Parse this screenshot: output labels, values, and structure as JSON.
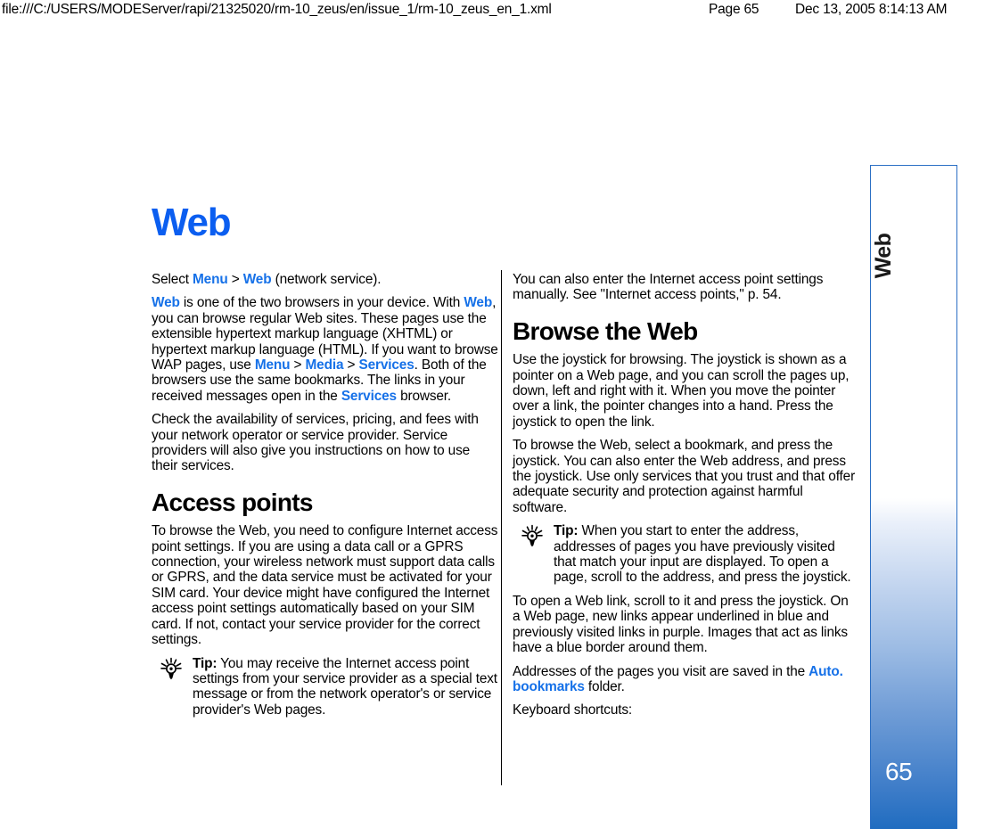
{
  "print_header": {
    "url": "file:///C:/USERS/MODEServer/rapi/21325020/rm-10_zeus/en/issue_1/rm-10_zeus_en_1.xml",
    "page": "Page 65",
    "date": "Dec 13, 2005 8:14:13 AM"
  },
  "page": {
    "title": "Web",
    "accent_title_color": "#0b5ef0",
    "ui_term_color": "#1671e8",
    "tab_blue": "#1f6cc0"
  },
  "thumb_tab": {
    "label": "Web",
    "page_number": "65"
  },
  "left_column": {
    "p1": {
      "a": "Select ",
      "menu": "Menu",
      "gt1": " > ",
      "web": "Web",
      "b": " (network service)."
    },
    "p2": {
      "web1": "Web",
      "a": " is one of the two browsers in your device. With ",
      "web2": "Web",
      "b": ", you can browse regular Web sites. These pages use the extensible hypertext markup language (XHTML) or hypertext markup language (HTML). If you want to browse WAP pages, use ",
      "menu": "Menu",
      "gt1": " > ",
      "media": "Media",
      "gt2": " > ",
      "services1": "Services",
      "c": ". Both of the browsers use the same bookmarks. The links in your received messages open in the ",
      "services2": "Services",
      "d": " browser."
    },
    "p3": "Check the availability of services, pricing, and fees with your network operator or service provider. Service providers will also give you instructions on how to use their services.",
    "heading_access_points": "Access points",
    "p4": "To browse the Web, you need to configure Internet access point settings. If you are using a data call or a GPRS connection, your wireless network must support data calls or GPRS, and the data service must be activated for your SIM card. Your device might have configured the Internet access point settings automatically based on your SIM card. If not, contact your service provider for the correct settings.",
    "tip": {
      "label": "Tip:",
      "text": " You may receive the Internet access point settings from your service provider as a special text message or from the network operator's or service provider's Web pages."
    }
  },
  "right_column": {
    "p1": "You can also enter the Internet access point settings manually. See \"Internet access points,\" p. 54.",
    "heading_browse_the_web": "Browse the Web",
    "p2": "Use the joystick for browsing. The joystick is shown as a pointer on a Web page, and you can scroll the pages up, down, left and right with it. When you move the pointer over a link, the pointer changes into a hand. Press the joystick to open the link.",
    "p3": "To browse the Web, select a bookmark, and press the joystick. You can also enter the Web address, and press the joystick. Use only services that you trust and that offer adequate security and protection against harmful software.",
    "tip": {
      "label": "Tip:",
      "text": " When you start to enter the address, addresses of pages you have previously visited that match your input are displayed. To open a page, scroll to the address, and press the joystick."
    },
    "p4": "To open a Web link, scroll to it and press the joystick. On a Web page, new links appear underlined in blue and previously visited links in purple. Images that act as links have a blue border around them.",
    "p5": {
      "a": "Addresses of the pages you visit are saved in the ",
      "auto_bookmarks": "Auto. bookmarks",
      "b": " folder."
    },
    "p6": "Keyboard shortcuts:"
  }
}
